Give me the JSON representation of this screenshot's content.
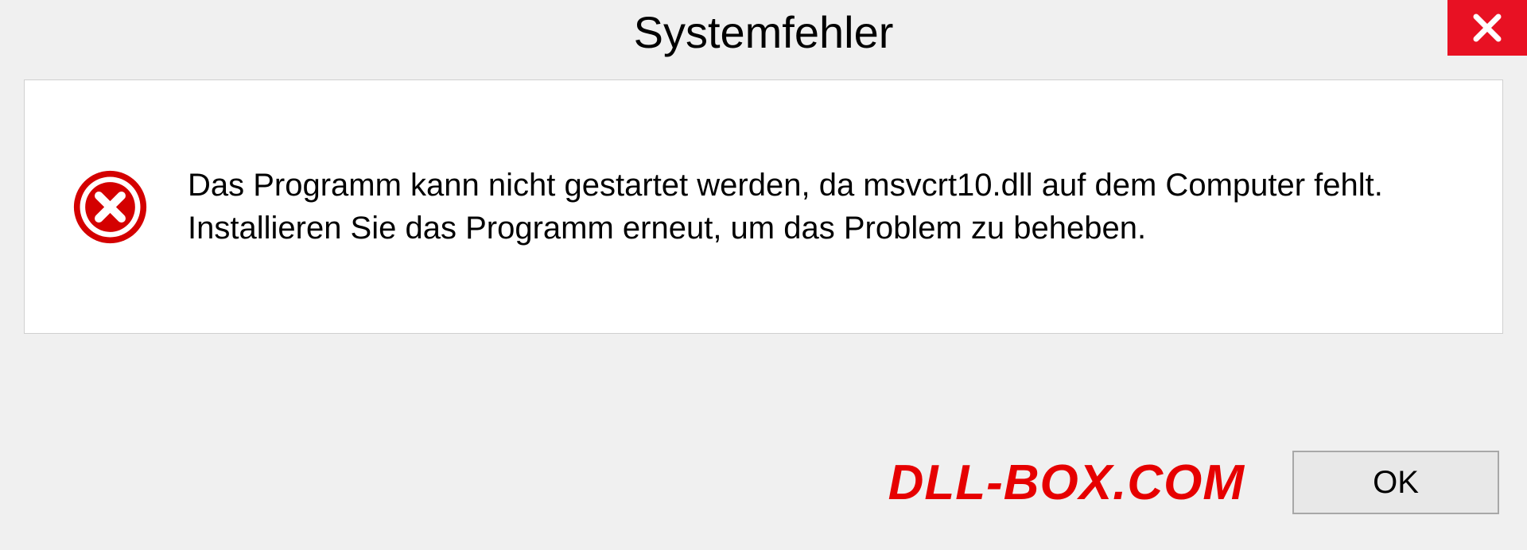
{
  "dialog": {
    "title": "Systemfehler",
    "message": "Das Programm kann nicht gestartet werden, da msvcrt10.dll auf dem Computer fehlt. Installieren Sie das Programm erneut, um das Problem zu beheben.",
    "ok_label": "OK"
  },
  "watermark": "DLL-BOX.COM",
  "colors": {
    "close_bg": "#e81123",
    "error_icon": "#d40000",
    "watermark": "#e60000"
  }
}
